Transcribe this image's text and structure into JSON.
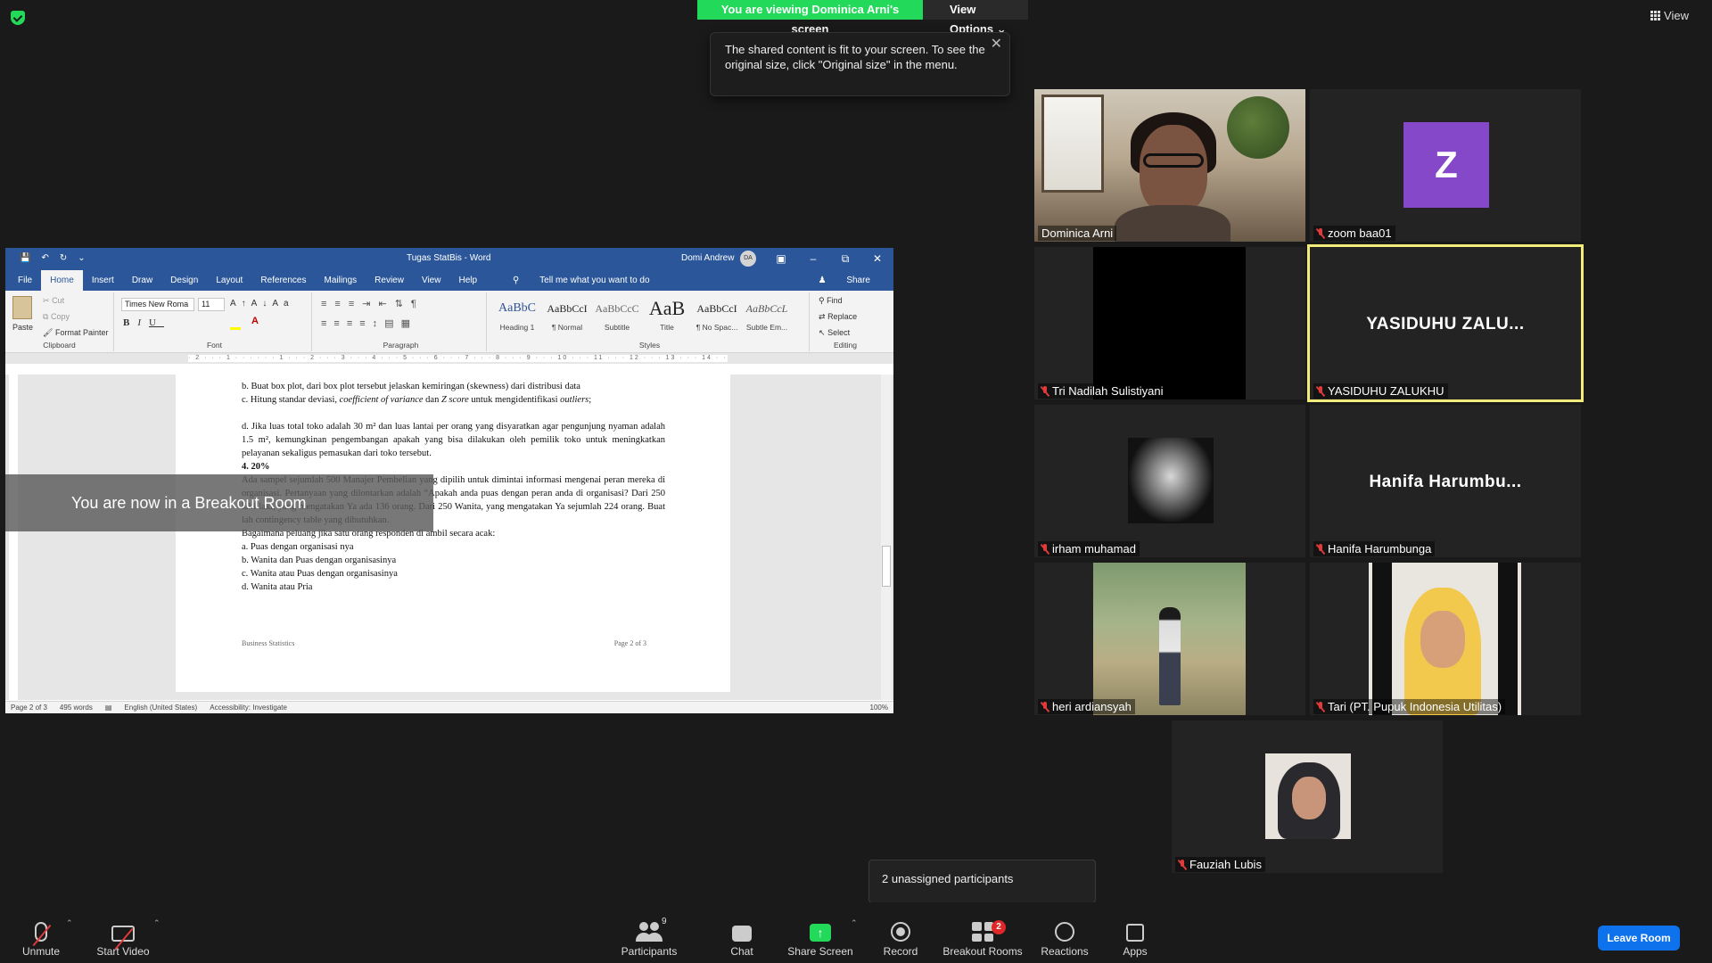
{
  "banner": {
    "viewing": "You are viewing Dominica Arni's screen",
    "view_options": "View Options"
  },
  "view_button": "View",
  "tooltip": {
    "text": "The shared content is fit to your screen. To see the original size, click \"Original size\" in the menu."
  },
  "word": {
    "title": "Tugas StatBis  -  Word",
    "user": "Domi Andrew",
    "user_initials": "DA",
    "tabs": [
      "File",
      "Home",
      "Insert",
      "Draw",
      "Design",
      "Layout",
      "References",
      "Mailings",
      "Review",
      "View",
      "Help"
    ],
    "tell_me": "Tell me what you want to do",
    "share": "Share",
    "clipboard": {
      "paste": "Paste",
      "cut": "Cut",
      "copy": "Copy",
      "format_painter": "Format Painter",
      "label": "Clipboard"
    },
    "font": {
      "name": "Times New Roma",
      "size": "11",
      "label": "Font"
    },
    "paragraph_label": "Paragraph",
    "styles": [
      {
        "preview": "AaBbC",
        "name": "Heading 1"
      },
      {
        "preview": "AaBbCcI",
        "name": "¶ Normal"
      },
      {
        "preview": "AaBbCcC",
        "name": "Subtitle"
      },
      {
        "preview": "AaB",
        "name": "Title"
      },
      {
        "preview": "AaBbCcI",
        "name": "¶ No Spac..."
      },
      {
        "preview": "AaBbCcL",
        "name": "Subtle Em..."
      }
    ],
    "styles_label": "Styles",
    "editing": {
      "find": "Find",
      "replace": "Replace",
      "select": "Select",
      "label": "Editing"
    },
    "doc": {
      "line_b": "b. Buat box plot, dari box plot tersebut jelaskan kemiringan (skewness) dari distribusi data",
      "line_c_pre": "c. Hitung standar deviasi, ",
      "line_c_it1": "coefficient of variance",
      "line_c_mid": " dan ",
      "line_c_it2": "Z score",
      "line_c_post": " untuk mengidentifikasi ",
      "line_c_it3": "outliers",
      "line_c_end": ";",
      "para_d": "d. Jika luas total toko adalah 30 m² dan luas lantai per orang yang disyaratkan agar pengunjung nyaman adalah 1.5 m², kemungkinan pengembangan apakah yang bisa dilakukan oleh pemilik toko untuk meningkatkan pelayanan sekaligus pemasukan dari toko tersebut.",
      "section": "4. 20%",
      "para_4": "Ada sampel sejumlah 500 Manajer Pembelian yang dipilih untuk dimintai informasi mengenai peran mereka di organisasi. Pertanyaan yang dilontarkan adalah “Apakah anda puas dengan peran anda di organisasi? Dari 250 laki-laki, yang mengatakan Ya ada 136 orang. Dari 250 Wanita, yang mengatakan Ya sejumlah 224 orang. Buat lah contingency table yang dibutuhkan.",
      "para_4b": "Bagaimana peluang jika satu orang responden di ambil secara acak:",
      "opt_a": "a. Puas dengan organisasi nya",
      "opt_b": "b. Wanita dan Puas dengan organisasinya",
      "opt_c": "c. Wanita atau Puas dengan organisasinya",
      "opt_d": "d. Wanita atau Pria",
      "footer_left": "Business Statistics",
      "footer_right": "Page 2 of 3"
    },
    "status": {
      "page": "Page 2 of 3",
      "words": "495 words",
      "language": "English (United States)",
      "accessibility": "Accessibility: Investigate",
      "zoom": "100%"
    }
  },
  "breakout_message": "You are now in a Breakout Room",
  "participants": [
    {
      "name": "Dominica Arni",
      "muted": false,
      "type": "video"
    },
    {
      "name": "zoom baa01",
      "muted": true,
      "type": "avatar",
      "initial": "Z"
    },
    {
      "name": "Tri Nadilah Sulistiyani",
      "muted": true,
      "type": "black"
    },
    {
      "name": "YASIDUHU ZALUKHU",
      "muted": true,
      "type": "name",
      "display": "YASIDUHU  ZALU...",
      "active_speaker": true
    },
    {
      "name": "irham muhamad",
      "muted": true,
      "type": "photo"
    },
    {
      "name": "Hanifa Harumbunga",
      "muted": true,
      "type": "name",
      "display": "Hanifa  Harumbu..."
    },
    {
      "name": "heri ardiansyah",
      "muted": true,
      "type": "photo"
    },
    {
      "name": "Tari (PT. Pupuk Indonesia Utilitas)",
      "muted": true,
      "type": "video"
    },
    {
      "name": "Fauziah Lubis",
      "muted": true,
      "type": "photo"
    }
  ],
  "unassigned": "2 unassigned participants",
  "toolbar": {
    "unmute": "Unmute",
    "start_video": "Start Video",
    "participants": "Participants",
    "participants_count": "9",
    "chat": "Chat",
    "share_screen": "Share Screen",
    "record": "Record",
    "breakout_rooms": "Breakout Rooms",
    "breakout_badge": "2",
    "reactions": "Reactions",
    "apps": "Apps",
    "leave": "Leave Room"
  },
  "colors": {
    "banner_green": "#23d959",
    "word_blue": "#2b579a",
    "active_speaker": "#f2ec7a",
    "avatar_purple": "#8548c8",
    "leave_blue": "#0e72ed",
    "badge_red": "#e02828"
  }
}
